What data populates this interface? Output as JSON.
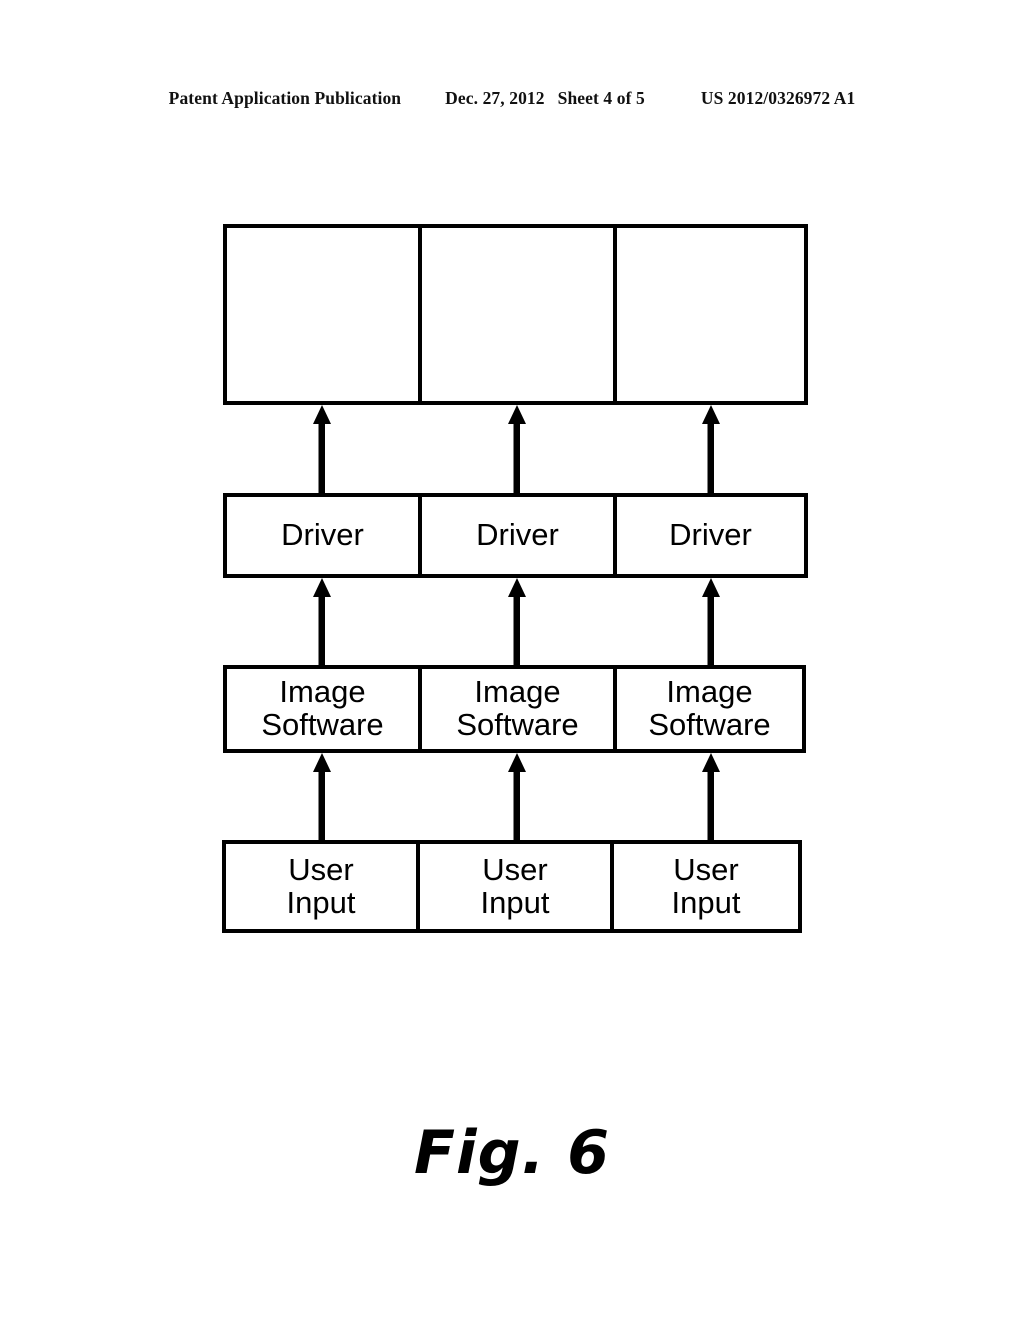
{
  "header": {
    "publication": "Patent Application Publication",
    "date": "Dec. 27, 2012",
    "sheet": "Sheet 4 of 5",
    "doc_number": "US 2012/0326972 A1"
  },
  "figure": {
    "caption": "Fig. 6",
    "stroke_color": "#000000",
    "fill_color": "#ffffff",
    "rows": [
      {
        "id": "display-row",
        "label": "",
        "cells": [
          {
            "line1": "",
            "line2": ""
          },
          {
            "line1": "",
            "line2": ""
          },
          {
            "line1": "",
            "line2": ""
          }
        ]
      },
      {
        "id": "driver-row",
        "label": "Driver",
        "cells": [
          {
            "line1": "Driver",
            "line2": ""
          },
          {
            "line1": "Driver",
            "line2": ""
          },
          {
            "line1": "Driver",
            "line2": ""
          }
        ]
      },
      {
        "id": "image-software-row",
        "label": "Image Software",
        "cells": [
          {
            "line1": "Image",
            "line2": "Software"
          },
          {
            "line1": "Image",
            "line2": "Software"
          },
          {
            "line1": "Image",
            "line2": "Software"
          }
        ]
      },
      {
        "id": "user-input-row",
        "label": "User Input",
        "cells": [
          {
            "line1": "User",
            "line2": "Input"
          },
          {
            "line1": "User",
            "line2": "Input"
          },
          {
            "line1": "User",
            "line2": "Input"
          }
        ]
      }
    ],
    "arrows": {
      "direction": "up",
      "columns": [
        322,
        517,
        711
      ],
      "bands": [
        {
          "from": "image-software-row",
          "to": "driver-row"
        },
        {
          "from": "driver-row",
          "to": "display-row"
        },
        {
          "from": "user-input-row",
          "to": "image-software-row"
        }
      ]
    }
  }
}
